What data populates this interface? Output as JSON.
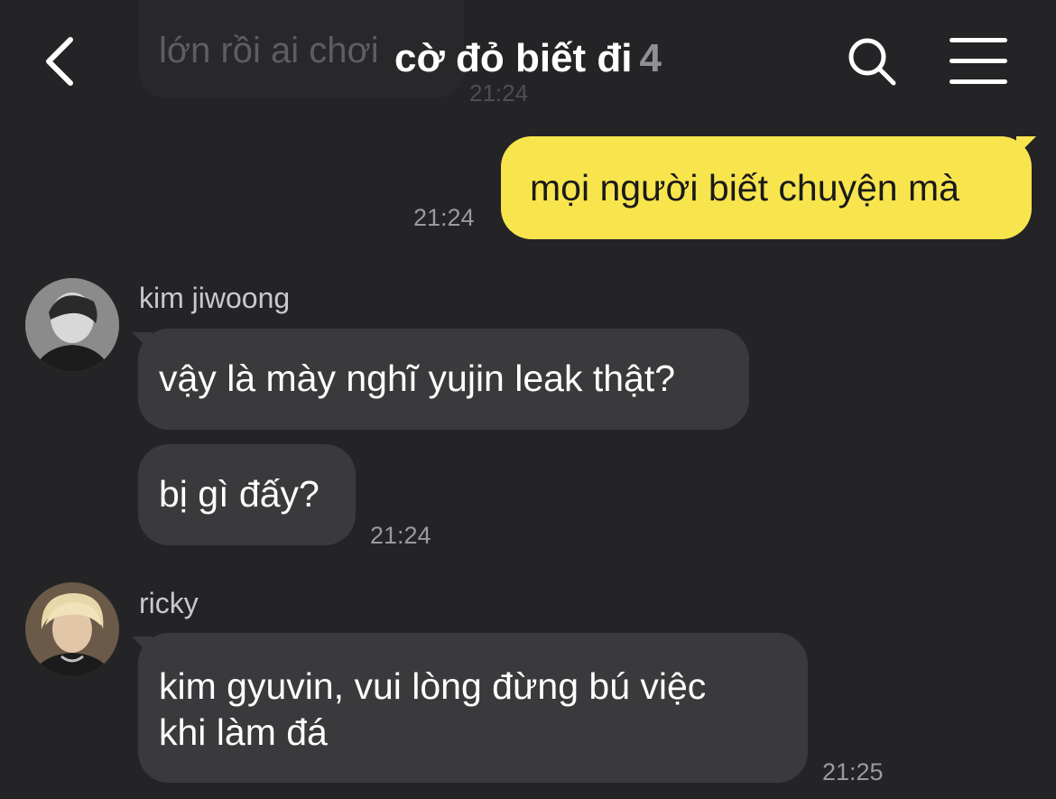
{
  "header": {
    "title": "cờ đỏ biết đi",
    "member_count": "4",
    "back_icon": "chevron-left-icon",
    "search_icon": "search-icon",
    "menu_icon": "hamburger-menu-icon"
  },
  "ghost_message": {
    "text": "lớn rồi ai chơi",
    "time": "21:24"
  },
  "messages": [
    {
      "sender": "me",
      "text": "mọi người biết chuyện mà",
      "time": "21:24"
    },
    {
      "sender": "kim jiwoong",
      "text": "vậy là mày nghĩ yujin leak thật?"
    },
    {
      "sender": "kim jiwoong",
      "text": "bị gì đấy?",
      "time": "21:24"
    },
    {
      "sender": "ricky",
      "text_line1": "kim gyuvin, vui lòng đừng bú việc",
      "text_line2": "khi làm đá",
      "time": "21:25"
    }
  ],
  "colors": {
    "background": "#242427",
    "incoming_bubble": "#3a3a3d",
    "outgoing_bubble": "#f8e54d"
  }
}
